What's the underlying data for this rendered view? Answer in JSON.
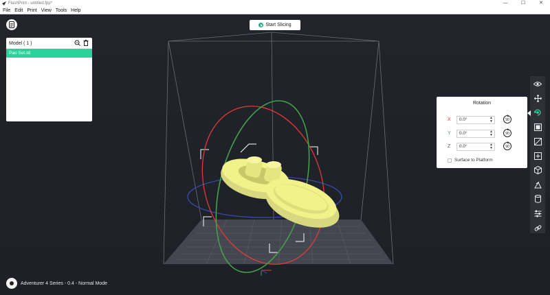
{
  "window": {
    "title": "FlashPrint - untitled.fpp*",
    "minimize": "—",
    "maximize": "☐",
    "close": "✕"
  },
  "menu": {
    "items": [
      "File",
      "Edit",
      "Print",
      "View",
      "Tools",
      "Help"
    ]
  },
  "toolbar_top": {
    "start_slicing": "Start Slicing"
  },
  "model_panel": {
    "title": "Model ( 1 )",
    "items": [
      {
        "name": "Pao Set.stl",
        "selected": true
      }
    ]
  },
  "rotation_panel": {
    "title": "Rotation",
    "rows": [
      {
        "axis": "X",
        "value": "0.0°",
        "color": "#e53935",
        "rotate_label": "90"
      },
      {
        "axis": "Y",
        "value": "0.0°",
        "color": "#43a047",
        "rotate_label": "90"
      },
      {
        "axis": "Z",
        "value": "0.0°",
        "color": "#555555",
        "rotate_label": "90"
      }
    ],
    "surface_label": "Surface to Platform",
    "surface_checked": false
  },
  "right_toolbar": {
    "tools": [
      {
        "icon": "eye-icon",
        "active": false
      },
      {
        "icon": "move-icon",
        "active": false
      },
      {
        "icon": "rotate-icon",
        "active": true
      },
      {
        "icon": "scale-icon",
        "active": false
      },
      {
        "icon": "cut-icon",
        "active": false
      },
      {
        "icon": "add-part-icon",
        "active": false
      },
      {
        "icon": "cube-icon",
        "active": false
      },
      {
        "icon": "support-icon",
        "active": false
      },
      {
        "icon": "cylinder-icon",
        "active": false
      },
      {
        "icon": "settings-sliders-icon",
        "active": false
      },
      {
        "icon": "link-icon",
        "active": false
      }
    ]
  },
  "status": {
    "printer": "Adventurer 4 Series - 0.4 - Normal Mode"
  },
  "colors": {
    "accent": "#2ad39a",
    "model": "#f2f28a",
    "ring_x": "#e53935",
    "ring_y": "#43a047",
    "ring_z": "#3949ab"
  }
}
